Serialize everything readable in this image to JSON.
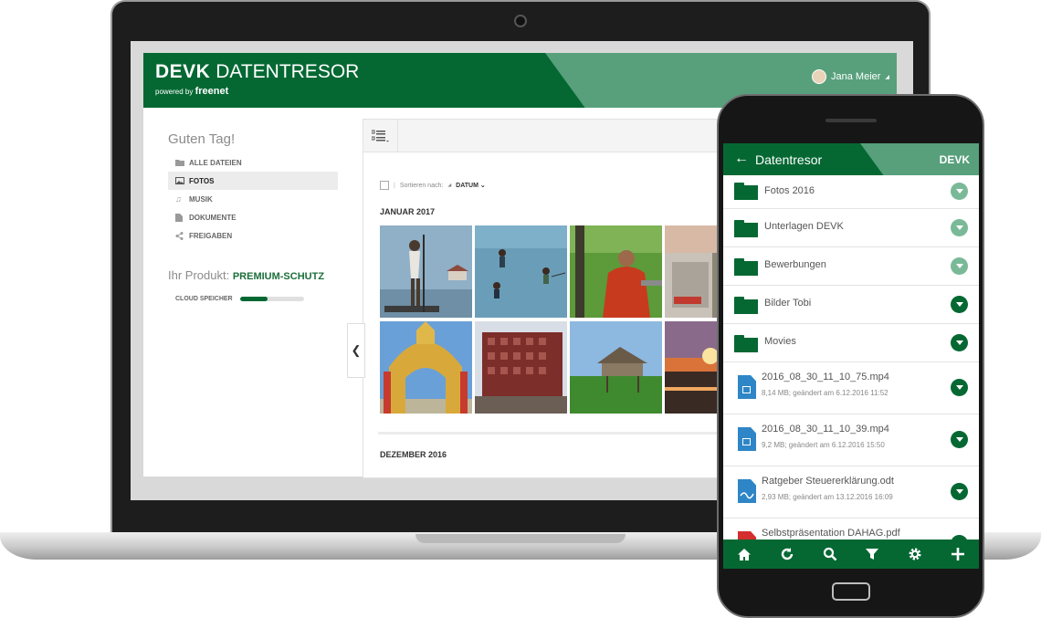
{
  "desktop": {
    "brand_name": "DEVK",
    "brand_product": "DATENTRESOR",
    "powered_by": "powered by",
    "powered_brand": "freenet",
    "user_name": "Jana Meier",
    "greeting": "Guten Tag!",
    "nav": [
      {
        "label": "ALLE DATEIEN",
        "icon": "folder-icon"
      },
      {
        "label": "FOTOS",
        "icon": "image-icon",
        "active": true
      },
      {
        "label": "MUSIK",
        "icon": "music-note-icon"
      },
      {
        "label": "DOKUMENTE",
        "icon": "document-icon"
      },
      {
        "label": "FREIGABEN",
        "icon": "share-icon"
      }
    ],
    "product_label": "Ihr Produkt:",
    "product_value": "PREMIUM-SCHUTZ",
    "cloud_label": "CLOUD SPEICHER",
    "cloud_usage_fraction": 0.43,
    "sort_label": "Sortieren nach:",
    "sort_value": "DATUM",
    "month_1": "JANUAR 2017",
    "month_2": "DEZEMBER 2016"
  },
  "phone": {
    "title": "Datentresor",
    "logo": "DEVK",
    "folders": [
      "Fotos 2016",
      "Unterlagen DEVK",
      "Bewerbungen",
      "Bilder Tobi",
      "Movies"
    ],
    "files": [
      {
        "name": "2016_08_30_11_10_75.mp4",
        "meta": "8,14 MB; geändert am 6.12.2016 11:52",
        "icon": "video-file-icon"
      },
      {
        "name": "2016_08_30_11_10_39.mp4",
        "meta": "9,2 MB; geändert am 6.12.2016 15:50",
        "icon": "video-file-icon"
      },
      {
        "name": "Ratgeber Steuererklärung.odt",
        "meta": "2,93 MB; geändert am 13.12.2016 16:09",
        "icon": "document-file-icon"
      },
      {
        "name": "Selbstpräsentation DAHAG.pdf",
        "meta": "",
        "icon": "pdf-file-icon"
      }
    ],
    "footer_icons": [
      "home-icon",
      "refresh-icon",
      "search-icon",
      "filter-icon",
      "settings-icon",
      "add-icon"
    ]
  },
  "colors": {
    "primary": "#056833",
    "accent": "#57a07b"
  }
}
